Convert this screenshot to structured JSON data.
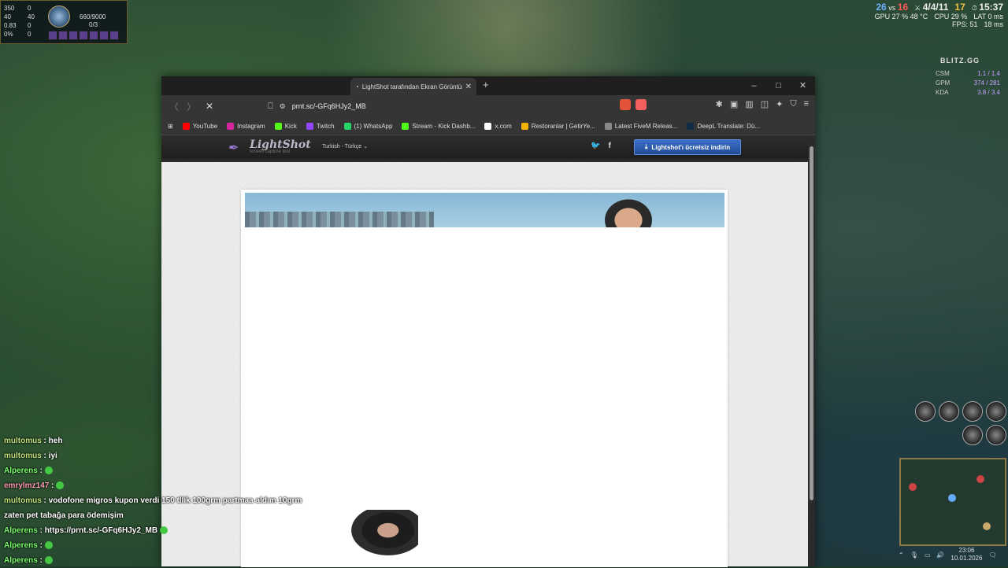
{
  "game_hud": {
    "top_left": {
      "stat_values": [
        "350",
        "0",
        "40",
        "40",
        "0.83",
        "0",
        "0%",
        "0"
      ],
      "hp": "660/9000",
      "cs": "0/3"
    },
    "top_right": {
      "kills_blue": "26",
      "vs": "vs",
      "kills_red": "16",
      "kda": "4/4/11",
      "cs": "17",
      "time": "15:37",
      "gpu": "GPU 27 % 48 °C",
      "cpu": "CPU 29 %",
      "lat": "LAT 0 ms",
      "fps": "FPS: 51",
      "ping": "18 ms"
    },
    "blitz": {
      "brand": "BLITZ.GG",
      "rows": [
        {
          "label": "CSM",
          "value": "1.1 / 1.4"
        },
        {
          "label": "GPM",
          "value": "374 / 281"
        },
        {
          "label": "KDA",
          "value": "3.8 / 3.4"
        }
      ]
    }
  },
  "browser": {
    "tab_title": "LightShot tarafından Ekran Görüntüsü",
    "url": "prnt.sc/-GFq6HJy2_MB",
    "window_controls": [
      "–",
      "□",
      "✕"
    ],
    "bookmarks": [
      {
        "label": "YouTube",
        "color": "#ff0000"
      },
      {
        "label": "Instagram",
        "color": "#d6249f"
      },
      {
        "label": "Kick",
        "color": "#53fc18"
      },
      {
        "label": "Twitch",
        "color": "#9146ff"
      },
      {
        "label": "(1) WhatsApp",
        "color": "#25d366"
      },
      {
        "label": "Stream - Kick Dashb...",
        "color": "#53fc18"
      },
      {
        "label": "x.com",
        "color": "#ffffff"
      },
      {
        "label": "Restoranlar | GetirYe...",
        "color": "#f5b400"
      },
      {
        "label": "Latest FiveM Releas...",
        "color": "#888888"
      },
      {
        "label": "DeepL Translate: Dü...",
        "color": "#0f2b46"
      }
    ]
  },
  "lightshot": {
    "logo": "LightShot",
    "tagline": "screen capture tool",
    "language": "Turkish - Türkçe",
    "download_button": "Lightshot'ı ücretsiz indirin"
  },
  "chat": [
    {
      "user": "multomus",
      "text": "heh",
      "cls": "u1"
    },
    {
      "user": "multomus",
      "text": "iyi",
      "cls": "u1"
    },
    {
      "user": "Alperens",
      "text": "",
      "cls": "u2",
      "emote": true
    },
    {
      "user": "emrylmz147",
      "text": "",
      "cls": "u3",
      "emote": true
    },
    {
      "user": "multomus",
      "text": "vodofone migros kupon verdi 150 tllik 100grm partmaa aldım 10grm",
      "cls": "u1"
    },
    {
      "user": "",
      "text": "zaten pet tabağa para ödemişim",
      "cls": "u1"
    },
    {
      "user": "Alperens",
      "text": "https://prnt.sc/-GFq6HJy2_MB",
      "cls": "u2",
      "emote": true
    },
    {
      "user": "Alperens",
      "text": "",
      "cls": "u2",
      "emote": true
    },
    {
      "user": "Alperens",
      "text": "",
      "cls": "u2",
      "emote": true
    }
  ],
  "taskbar": {
    "time": "23:06",
    "date": "10.01.2026"
  }
}
